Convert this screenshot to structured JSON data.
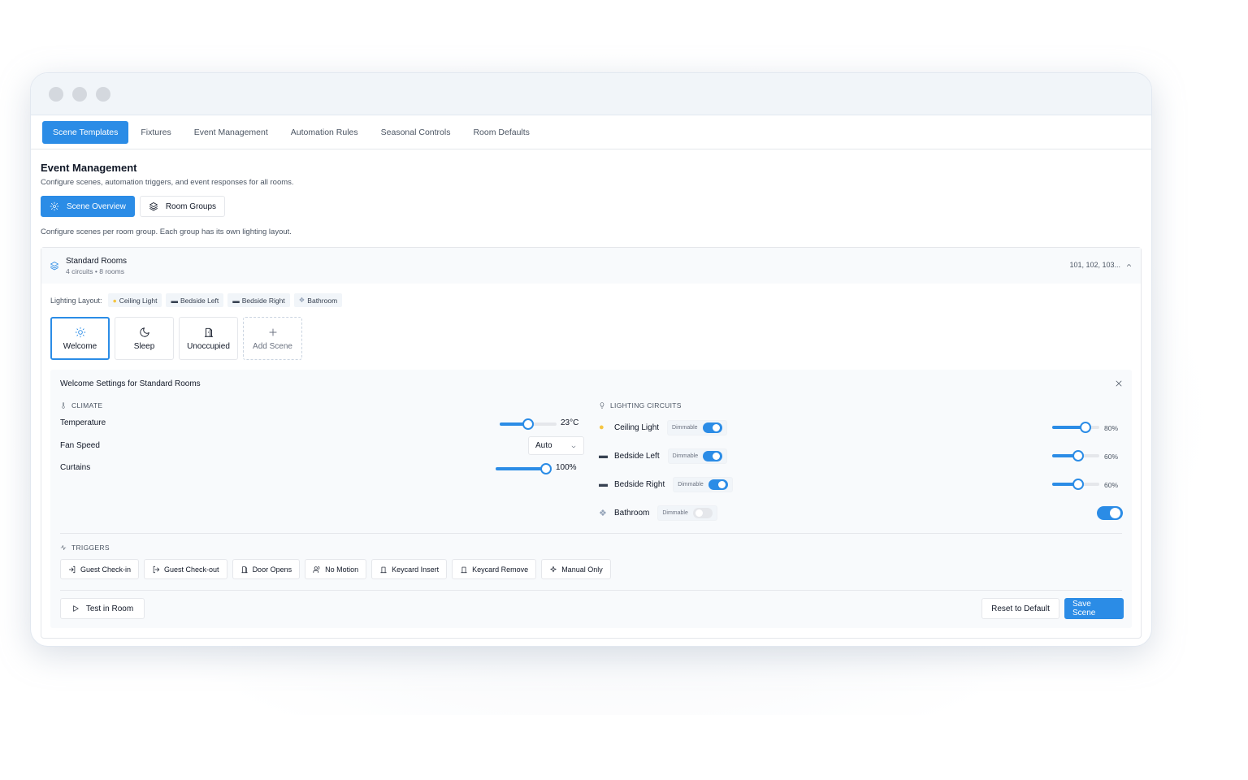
{
  "nav": {
    "tabs": [
      {
        "label": "Scene Templates",
        "active": true
      },
      {
        "label": "Fixtures"
      },
      {
        "label": "Event Management"
      },
      {
        "label": "Automation Rules"
      },
      {
        "label": "Seasonal Controls"
      },
      {
        "label": "Room Defaults"
      }
    ]
  },
  "page": {
    "title": "Event Management",
    "subtitle": "Configure scenes, automation triggers, and event responses for all rooms."
  },
  "subtabs": [
    {
      "label": "Scene Overview",
      "icon": "gear-icon",
      "active": true
    },
    {
      "label": "Room Groups",
      "icon": "layers-icon"
    }
  ],
  "hint": "Configure scenes per room group. Each group has its own lighting layout.",
  "group": {
    "name": "Standard Rooms",
    "meta": "4 circuits • 8 rooms",
    "rooms": "101, 102, 103..."
  },
  "lighting_layout": {
    "label": "Lighting Layout:",
    "chips": [
      {
        "label": "Ceiling Light",
        "icon": "bulb-icon"
      },
      {
        "label": "Bedside Left",
        "icon": "bed-icon"
      },
      {
        "label": "Bedside Right",
        "icon": "bed-icon"
      },
      {
        "label": "Bathroom",
        "icon": "shower-icon"
      }
    ]
  },
  "scenes": [
    {
      "label": "Welcome",
      "icon": "sun-icon",
      "active": true
    },
    {
      "label": "Sleep",
      "icon": "moon-icon"
    },
    {
      "label": "Unoccupied",
      "icon": "door-icon"
    },
    {
      "label": "Add Scene",
      "icon": "plus-icon"
    }
  ],
  "settings": {
    "title": "Welcome Settings for Standard Rooms",
    "climate_label": "CLIMATE",
    "temperature": {
      "label": "Temperature",
      "value": "23°C",
      "level": 0.5
    },
    "fan_speed": {
      "label": "Fan Speed",
      "value": "Auto"
    },
    "curtains": {
      "label": "Curtains",
      "value": "100%",
      "level": 1.0
    },
    "lighting_label": "LIGHTING CIRCUITS",
    "circuits": [
      {
        "name": "Ceiling Light",
        "tag": "Dimmable",
        "dimmable_on": true,
        "value": "80%",
        "level": 0.8,
        "icon": "bulb-icon"
      },
      {
        "name": "Bedside Left",
        "tag": "Dimmable",
        "dimmable_on": true,
        "value": "60%",
        "level": 0.6,
        "icon": "bed-icon"
      },
      {
        "name": "Bedside Right",
        "tag": "Dimmable",
        "dimmable_on": true,
        "value": "60%",
        "level": 0.6,
        "icon": "bed-icon"
      },
      {
        "name": "Bathroom",
        "tag": "Dimmable",
        "dimmable_on": false,
        "switch_on": true,
        "icon": "shower-icon"
      }
    ],
    "triggers_label": "TRIGGERS",
    "triggers": [
      {
        "label": "Guest Check-in",
        "icon": "login-icon"
      },
      {
        "label": "Guest Check-out",
        "icon": "logout-icon"
      },
      {
        "label": "Door Opens",
        "icon": "door-icon"
      },
      {
        "label": "No Motion",
        "icon": "users-icon"
      },
      {
        "label": "Keycard Insert",
        "icon": "keycard-icon"
      },
      {
        "label": "Keycard Remove",
        "icon": "keycard-icon"
      },
      {
        "label": "Manual Only",
        "icon": "sparkle-icon"
      }
    ],
    "test_label": "Test in Room",
    "reset_label": "Reset to Default",
    "save_label": "Save Scene"
  },
  "colors": {
    "accent": "#2b8ce6",
    "panel": "#f8fafc",
    "border": "#e5e7eb"
  }
}
